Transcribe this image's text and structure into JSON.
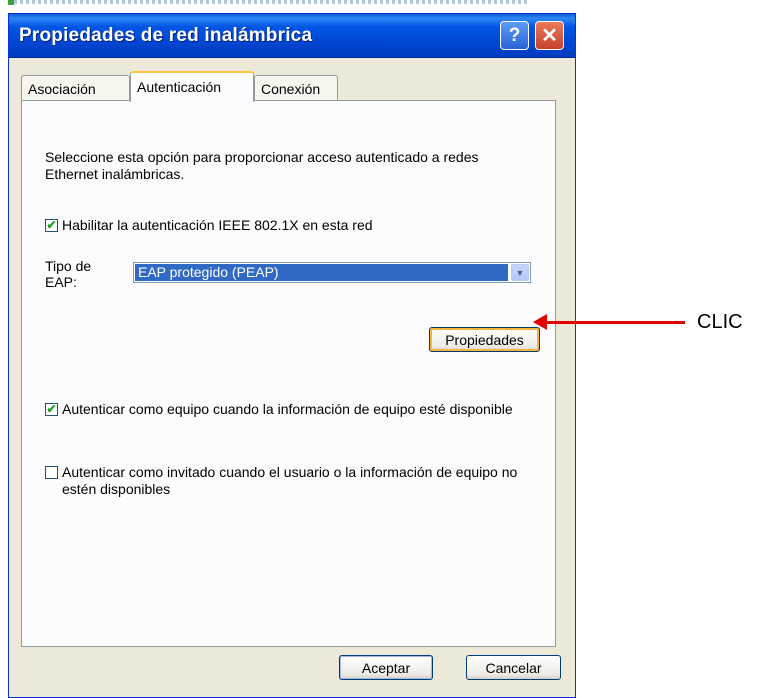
{
  "window": {
    "title": "Propiedades de red inalámbrica",
    "help_label": "?",
    "close_label": "✕"
  },
  "tabs": [
    {
      "label": "Asociación"
    },
    {
      "label": "Autenticación"
    },
    {
      "label": "Conexión"
    }
  ],
  "authentication": {
    "description": "Seleccione esta opción para proporcionar acceso autenticado a redes Ethernet inalámbricas.",
    "enable_8021x": {
      "label": "Habilitar la autenticación IEEE 802.1X en esta red",
      "checked": true
    },
    "eap_type_label": "Tipo de EAP:",
    "eap_type_value": "EAP protegido (PEAP)",
    "properties_button": "Propiedades",
    "auth_as_computer": {
      "label": "Autenticar como equipo cuando la información de equipo esté disponible",
      "checked": true
    },
    "auth_as_guest": {
      "label": "Autenticar como invitado cuando el usuario o la información de equipo no estén disponibles",
      "checked": false
    }
  },
  "footer": {
    "ok_label": "Aceptar",
    "cancel_label": "Cancelar"
  },
  "annotation": {
    "text": "CLIC",
    "color": "#e00000"
  },
  "colors": {
    "titlebar": "#0055e5",
    "selection": "#316ac5",
    "dialog_bg": "#ece9d8",
    "active_tab_accent": "#ffc83c"
  },
  "icons": {
    "checkmark": "✔",
    "dropdown": "▼"
  }
}
